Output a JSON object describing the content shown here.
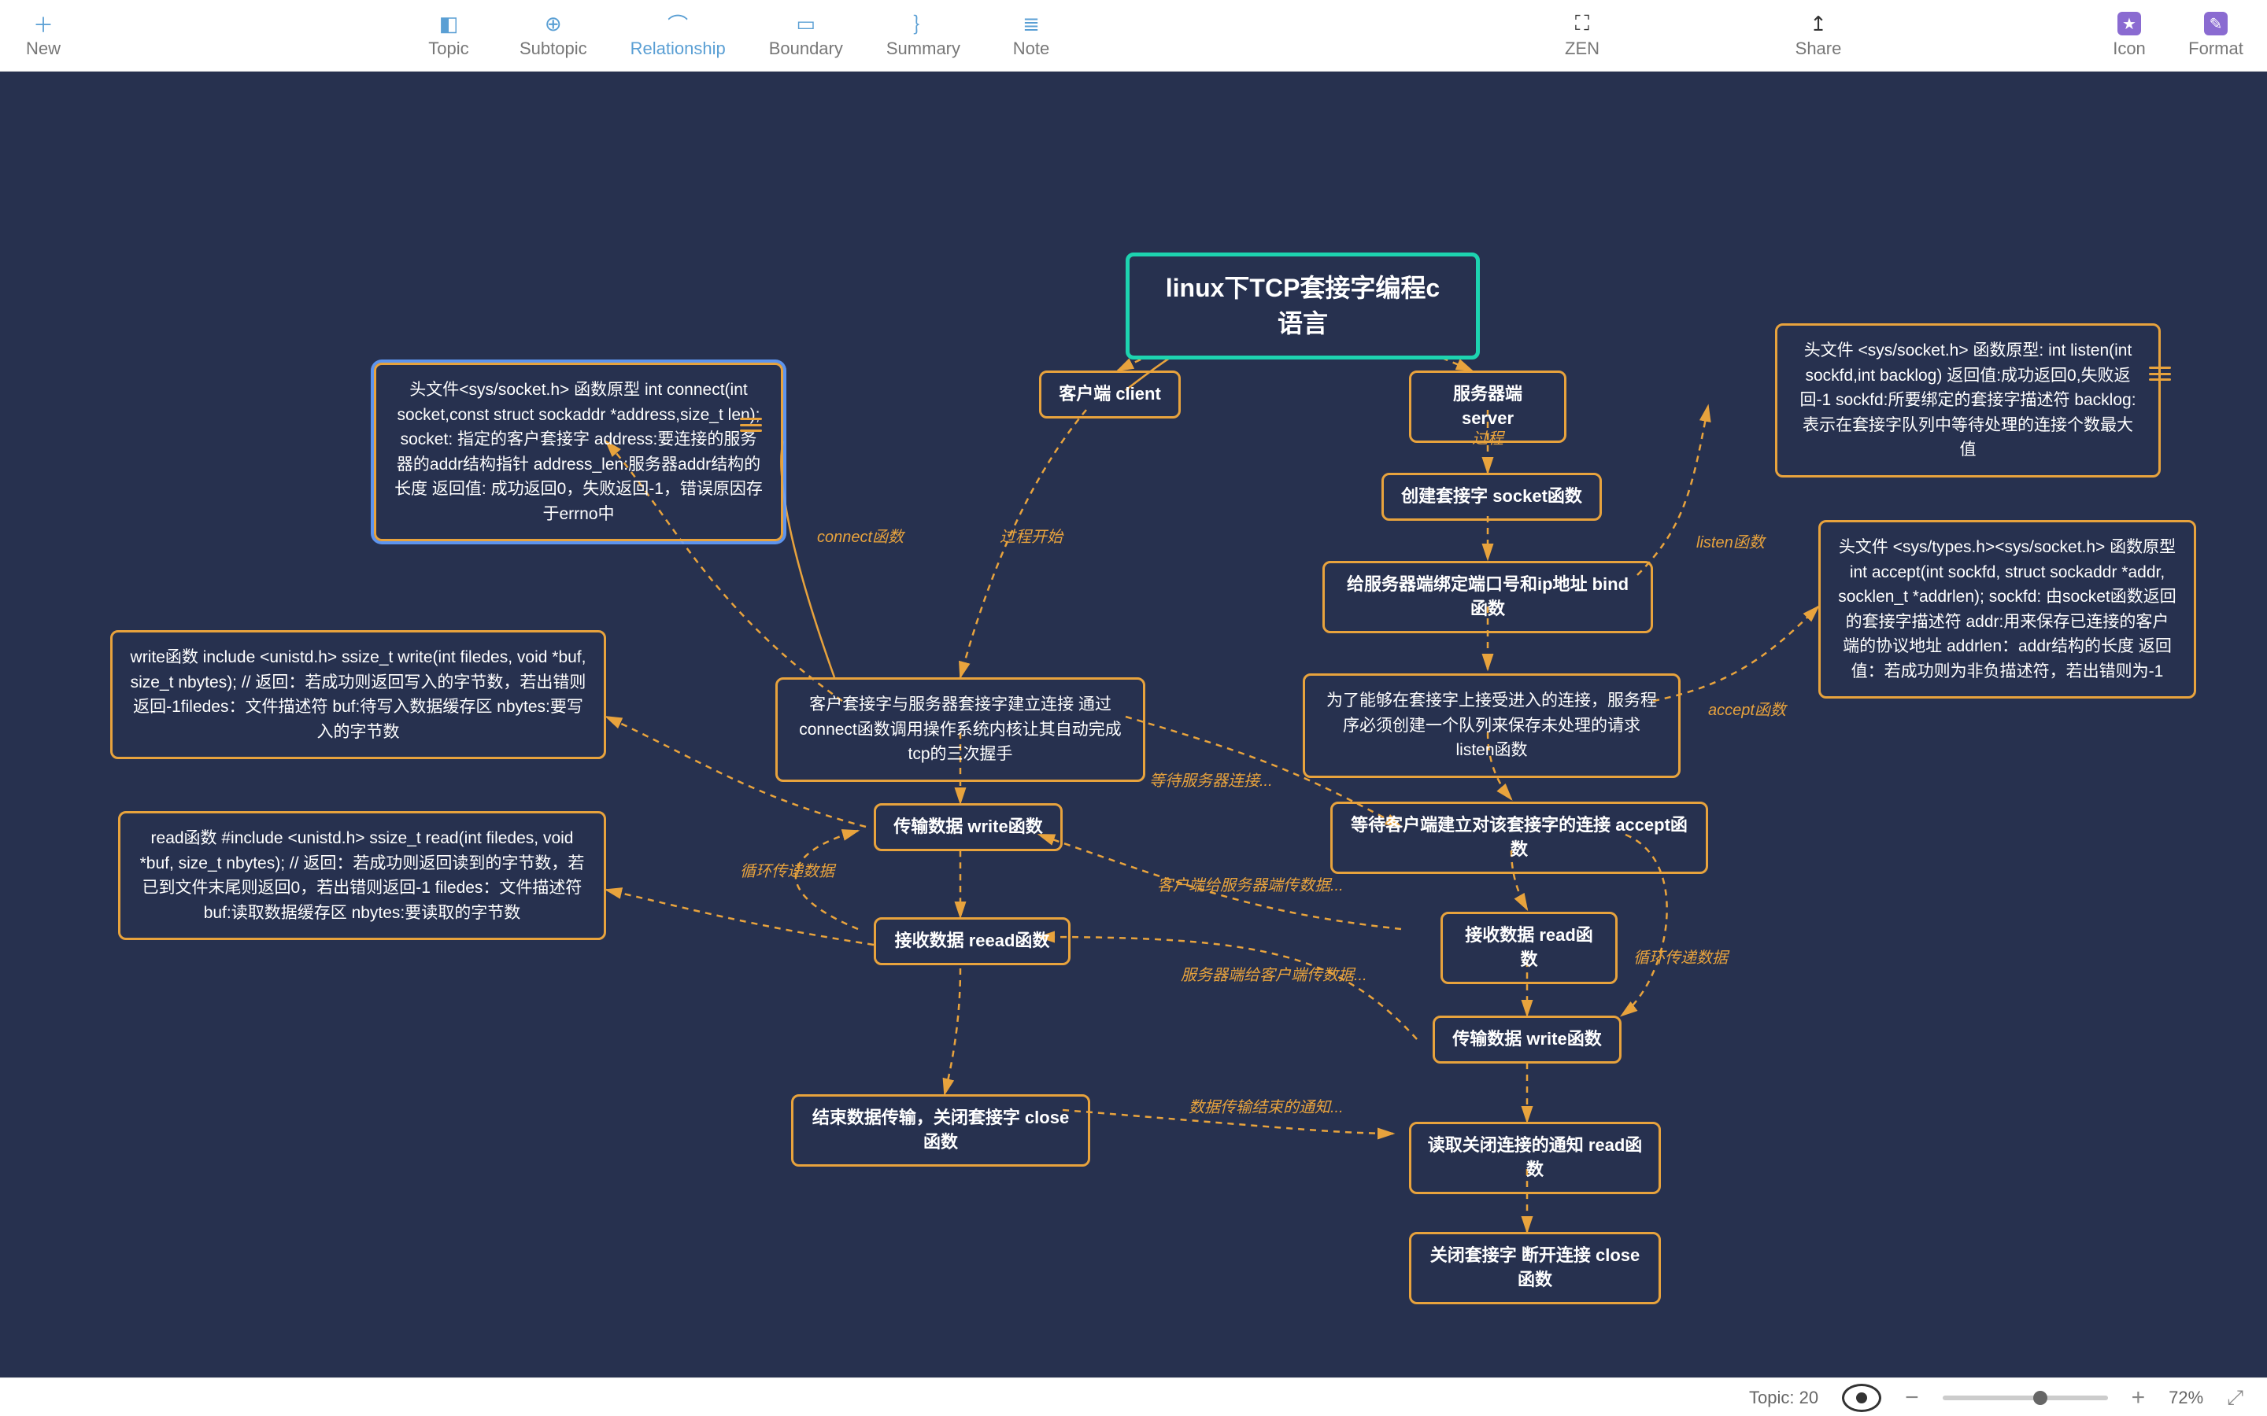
{
  "toolbar": {
    "new": "New",
    "topic": "Topic",
    "subtopic": "Subtopic",
    "relationship": "Relationship",
    "boundary": "Boundary",
    "summary": "Summary",
    "note": "Note",
    "zen": "ZEN",
    "share": "Share",
    "icon": "Icon",
    "format": "Format"
  },
  "nodes": {
    "root": "linux下TCP套接字编程c语言",
    "client": "客户端 client",
    "server": "服务器端 server",
    "s_socket": "创建套接字 socket函数",
    "s_bind": "给服务器端绑定端口号和ip地址  bind函数",
    "s_listen": "为了能够在套接字上接受进入的连接，服务程序必须创建一个队列来保存未处理的请求  listen函数",
    "s_accept": "等待客户端建立对该套接字的连接   accept函数",
    "s_read": "接收数据 read函数",
    "s_write": "传输数据  write函数",
    "s_readclose": "读取关闭连接的通知  read函数",
    "s_close": "关闭套接字  断开连接  close函数",
    "c_connect": "客户套接字与服务器套接字建立连接 通过connect函数调用操作系统内核让其自动完成tcp的三次握手",
    "c_write": "传输数据  write函数",
    "c_read": "接收数据  reead函数",
    "c_close": "结束数据传输，关闭套接字   close函数",
    "note_connect": "头文件<sys/socket.h>   函数原型 int connect(int socket,const struct sockaddr *address,size_t len);    socket: 指定的客户套接字  address:要连接的服务器的addr结构指针   address_len:服务器addr结构的长度   返回值: 成功返回0，失败返回-1，错误原因存于errno中",
    "note_write": "write函数 include <unistd.h>\nssize_t write(int filedes, void *buf, size_t nbytes);\n// 返回：若成功则返回写入的字节数，若出错则返回-1filedes：文件描述符  buf:待写入数据缓存区 nbytes:要写入的字节数",
    "note_read": "read函数 #include <unistd.h>\nssize_t read(int filedes, void *buf, size_t nbytes);\n// 返回：若成功则返回读到的字节数，若已到文件末尾则返回0，若出错则返回-1  filedes：文件描述符 buf:读取数据缓存区 nbytes:要读取的字节数",
    "note_listen": "头文件 <sys/socket.h> 函数原型: int listen(int sockfd,int backlog) 返回值:成功返回0,失败返回-1 sockfd:所要绑定的套接字描述符  backlog:表示在套接字队列中等待处理的连接个数最大值",
    "note_accept": "头文件 <sys/types.h><sys/socket.h>       函数原型 int accept(int sockfd, struct sockaddr *addr, socklen_t *addrlen);    sockfd: 由socket函数返回的套接字描述符  addr:用来保存已连接的客户端的协议地址 addrlen：addr结构的长度   返回值：若成功则为非负描述符，若出错则为-1"
  },
  "edges": {
    "e1": "过程",
    "e2": "过程开始",
    "e3": "connect函数",
    "e4": "等待服务器连接...",
    "e5": "客户端给服务器端传数据...",
    "e6": "服务器端给客户端传数据...",
    "e7": "数据传输结束的通知...",
    "e8": "循环传递数据",
    "e9": "循环传递数据",
    "e10": "listen函数",
    "e11": "accept函数"
  },
  "status": {
    "topic_label": "Topic:",
    "topic_count": "20",
    "zoom": "72%"
  }
}
